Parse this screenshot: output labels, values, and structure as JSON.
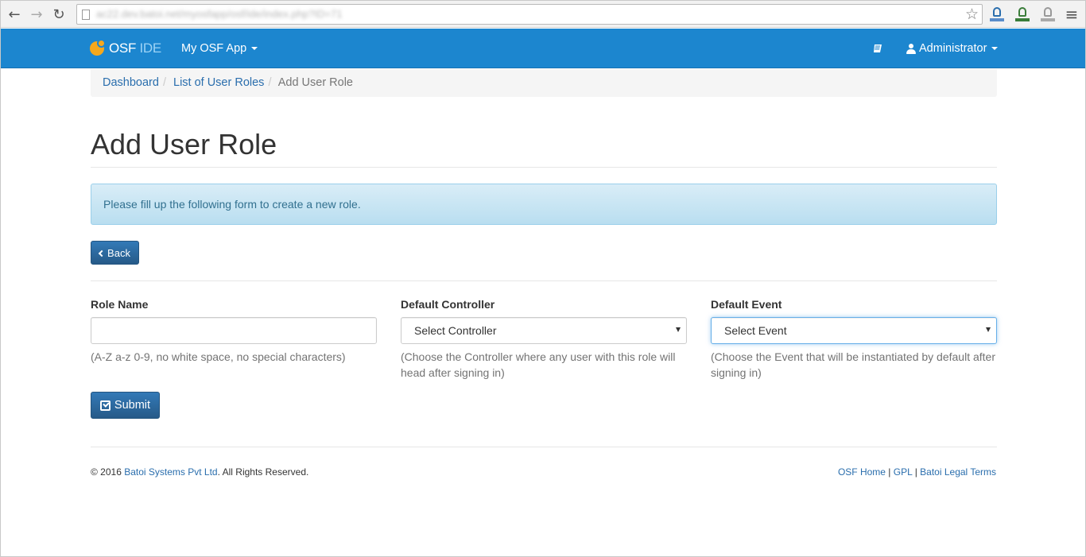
{
  "browser": {
    "url": "ac22.dev.batoi.net/myosfapp/osf/ide/index.php?ID=71"
  },
  "navbar": {
    "brand_osf": "OSF",
    "brand_ide": "IDE",
    "app_menu_label": "My OSF App",
    "admin_label": "Administrator"
  },
  "breadcrumb": {
    "items": [
      "Dashboard",
      "List of User Roles",
      "Add User Role"
    ]
  },
  "page": {
    "title": "Add User Role",
    "alert": "Please fill up the following form to create a new role.",
    "back_label": "Back",
    "submit_label": "Submit"
  },
  "form": {
    "role_name": {
      "label": "Role Name",
      "value": "",
      "help": "(A-Z a-z 0-9, no white space, no special characters)"
    },
    "default_controller": {
      "label": "Default Controller",
      "selected": "Select Controller",
      "help": "(Choose the Controller where any user with this role will head after signing in)"
    },
    "default_event": {
      "label": "Default Event",
      "selected": "Select Event",
      "help": "(Choose the Event that will be instantiated by default after signing in)"
    }
  },
  "footer": {
    "copyright_prefix": "© 2016",
    "company": "Batoi Systems Pvt Ltd",
    "copyright_suffix": ". All Rights Reserved.",
    "links": [
      "OSF Home",
      "GPL",
      "Batoi Legal Terms"
    ],
    "separator": "|"
  }
}
